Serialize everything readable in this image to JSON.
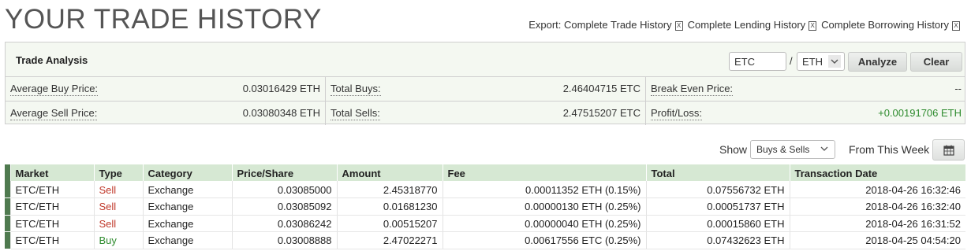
{
  "header": {
    "title": "YOUR TRADE HISTORY",
    "export_label": "Export:",
    "export_links": [
      "Complete Trade History",
      "Complete Lending History",
      "Complete Borrowing History"
    ]
  },
  "analysis": {
    "title": "Trade Analysis",
    "coin_value": "ETC",
    "separator": "/",
    "market_selected": "ETH",
    "analyze_label": "Analyze",
    "clear_label": "Clear",
    "rows": [
      [
        {
          "label": "Average Buy Price:",
          "value": "0.03016429 ETH"
        },
        {
          "label": "Total Buys:",
          "value": "2.46404715 ETC"
        },
        {
          "label": "Break Even Price:",
          "value": "--"
        }
      ],
      [
        {
          "label": "Average Sell Price:",
          "value": "0.03080348 ETH"
        },
        {
          "label": "Total Sells:",
          "value": "2.47515207 ETC"
        },
        {
          "label": "Profit/Loss:",
          "value": "+0.00191706 ETH"
        }
      ]
    ]
  },
  "filters": {
    "show_label": "Show",
    "show_selected": "Buys & Sells",
    "period_label": "From This Week"
  },
  "table": {
    "columns": [
      "Market",
      "Type",
      "Category",
      "Price/Share",
      "Amount",
      "Fee",
      "Total",
      "Transaction Date"
    ],
    "rows": [
      [
        "ETC/ETH",
        "Sell",
        "Exchange",
        "0.03085000",
        "2.45318770",
        "0.00011352 ETH (0.15%)",
        "0.07556732 ETH",
        "2018-04-26 16:32:46"
      ],
      [
        "ETC/ETH",
        "Sell",
        "Exchange",
        "0.03085092",
        "0.01681230",
        "0.00000130 ETH (0.25%)",
        "0.00051737 ETH",
        "2018-04-26 16:32:40"
      ],
      [
        "ETC/ETH",
        "Sell",
        "Exchange",
        "0.03086242",
        "0.00515207",
        "0.00000040 ETH (0.25%)",
        "0.00015860 ETH",
        "2018-04-26 16:31:52"
      ],
      [
        "ETC/ETH",
        "Buy",
        "Exchange",
        "0.03008888",
        "2.47022271",
        "0.00617556 ETC (0.25%)",
        "0.07432623 ETH",
        "2018-04-25 04:54:20"
      ]
    ]
  },
  "colors": {
    "sell": "#c0392b",
    "buy": "#2e8b2e",
    "profit": "#2e8b2e",
    "header_bg": "#d6e8d3",
    "row_marker": "#4f7a4f"
  }
}
